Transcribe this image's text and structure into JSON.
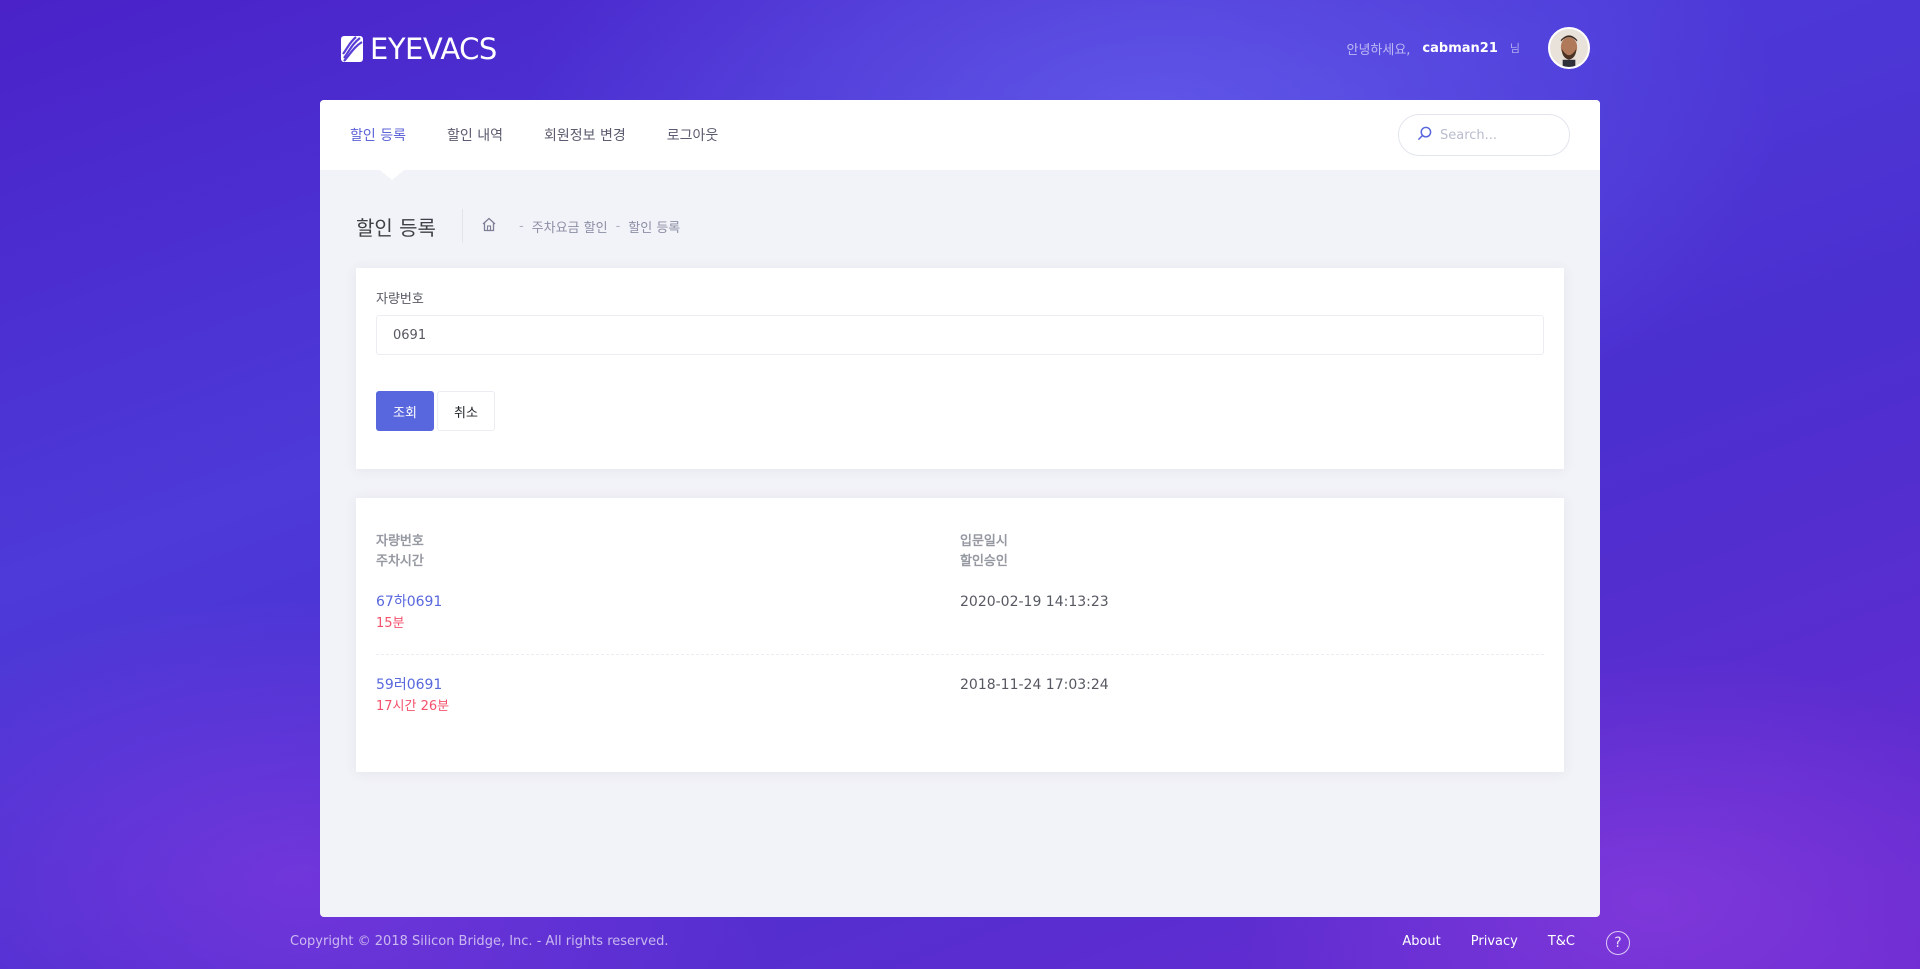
{
  "header": {
    "logo_text": "EYEVACS",
    "greeting": "안녕하세요,",
    "username": "cabman21",
    "user_caret": "님",
    "avatar_icon": "user-avatar"
  },
  "nav": {
    "items": [
      {
        "label": "할인 등록",
        "active": true
      },
      {
        "label": "할인 내역",
        "active": false
      },
      {
        "label": "회원정보 변경",
        "active": false
      },
      {
        "label": "로그아웃",
        "active": false
      }
    ],
    "search_placeholder": "Search..."
  },
  "subheader": {
    "title": "할인 등록",
    "home_icon": "home-icon",
    "breadcrumb": [
      "주차요금 할인",
      "할인 등록"
    ]
  },
  "form": {
    "plate_label": "자량번호",
    "plate_value": "0691",
    "search_button": "조회",
    "cancel_button": "취소"
  },
  "results": {
    "headers": {
      "col1_line1": "자량번호",
      "col1_line2": "주차시간",
      "col2_line1": "입문일시",
      "col2_line2": "할인승인"
    },
    "rows": [
      {
        "plate": "67하0691",
        "duration": "15분",
        "entry_time": "2020-02-19 14:13:23"
      },
      {
        "plate": "59러0691",
        "duration": "17시간 26분",
        "entry_time": "2018-11-24 17:03:24"
      }
    ]
  },
  "footer": {
    "copyright": "Copyright © 2018 Silicon Bridge, Inc. - All rights reserved.",
    "links": [
      "About",
      "Privacy",
      "T&C"
    ],
    "help_icon": "?"
  },
  "colors": {
    "accent": "#5867dd",
    "danger": "#f4516c",
    "nav_active": "#5d63d8"
  }
}
